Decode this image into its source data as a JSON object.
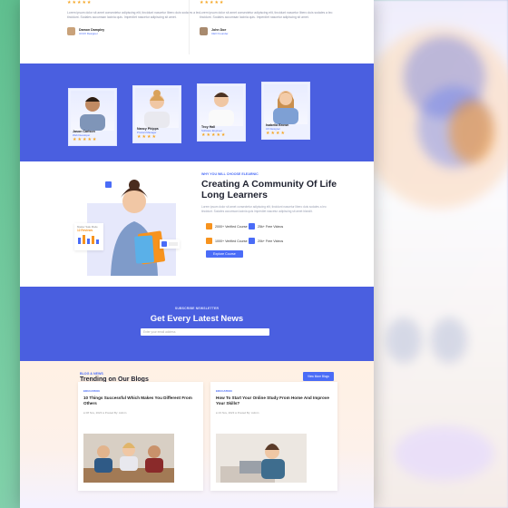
{
  "testimonials": [
    {
      "stars": "★★★★★",
      "text": "Lorem ipsum dolor sit amet consectetur adipiscing elit, tincidunt nascetur libero duis sodales a leo tincidunt. Sodales accumsan lacinia quis. Imperdiet nascetur adipiscing sit amet.",
      "name": "Damon Dampley",
      "role": "UI/UX Designer"
    },
    {
      "stars": "★★★★★",
      "text": "Lorem ipsum dolor sit amet consectetur adipiscing elit, tincidunt nascetur libero duis sodales a leo tincidunt. Sodales accumsan lacinia quis. Imperdiet nascetur adipiscing sit amet.",
      "name": "John Doe",
      "role": "CEO Founder"
    }
  ],
  "team": [
    {
      "name": "Jason Carlson",
      "role": "Web Developer",
      "stars": "★★★★★"
    },
    {
      "name": "Nancy Phipps",
      "role": "Product Manager",
      "stars": "★★★★"
    },
    {
      "name": "Troy Hall",
      "role": "Software Engineer",
      "stars": "★★★★★"
    },
    {
      "name": "Isabella Brown",
      "role": "UX Designer",
      "stars": "★★★★"
    }
  ],
  "community": {
    "eyebrow": "WHY YOU WILL CHOOSE ELEARNIC",
    "title": "Creating A Community Of Life Long Learners",
    "text": "Lorem ipsum dolor sit amet consectetur adipiscing elit, tincidunt nascetur libero duis sodales a leo tincidunt. Sodales accumsan lacinia quis imperdiet nascetur adipiscing sit amet blandit.",
    "badge_small": "Master Sale Mode",
    "badge_value": "12 Reviews",
    "stats": [
      "2000+ Verified Course",
      "25k+ Free Videos",
      "1000+ Verified Course",
      "20k+ Free Videos"
    ],
    "button": "Explore Course"
  },
  "newsletter": {
    "eyebrow": "SUBSCRIBE NEWSLETTER",
    "title": "Get Every Latest News",
    "placeholder": "Enter your email address"
  },
  "blog": {
    "eyebrow": "BLOG & NEWS",
    "title": "Trending on Our Blogs",
    "button": "View More Blogs",
    "posts": [
      {
        "tag": "EDUCATION",
        "title": "10 Things Successful Which Makes You Different From Others",
        "meta": "● 08 Nov, 2023   ● Posted By: Admin"
      },
      {
        "tag": "EDUCATION",
        "title": "How To Start Your Online Study From Home And Improve Your Skills?",
        "meta": "● 23 Nov, 2023   ● Posted By: Admin"
      }
    ]
  }
}
